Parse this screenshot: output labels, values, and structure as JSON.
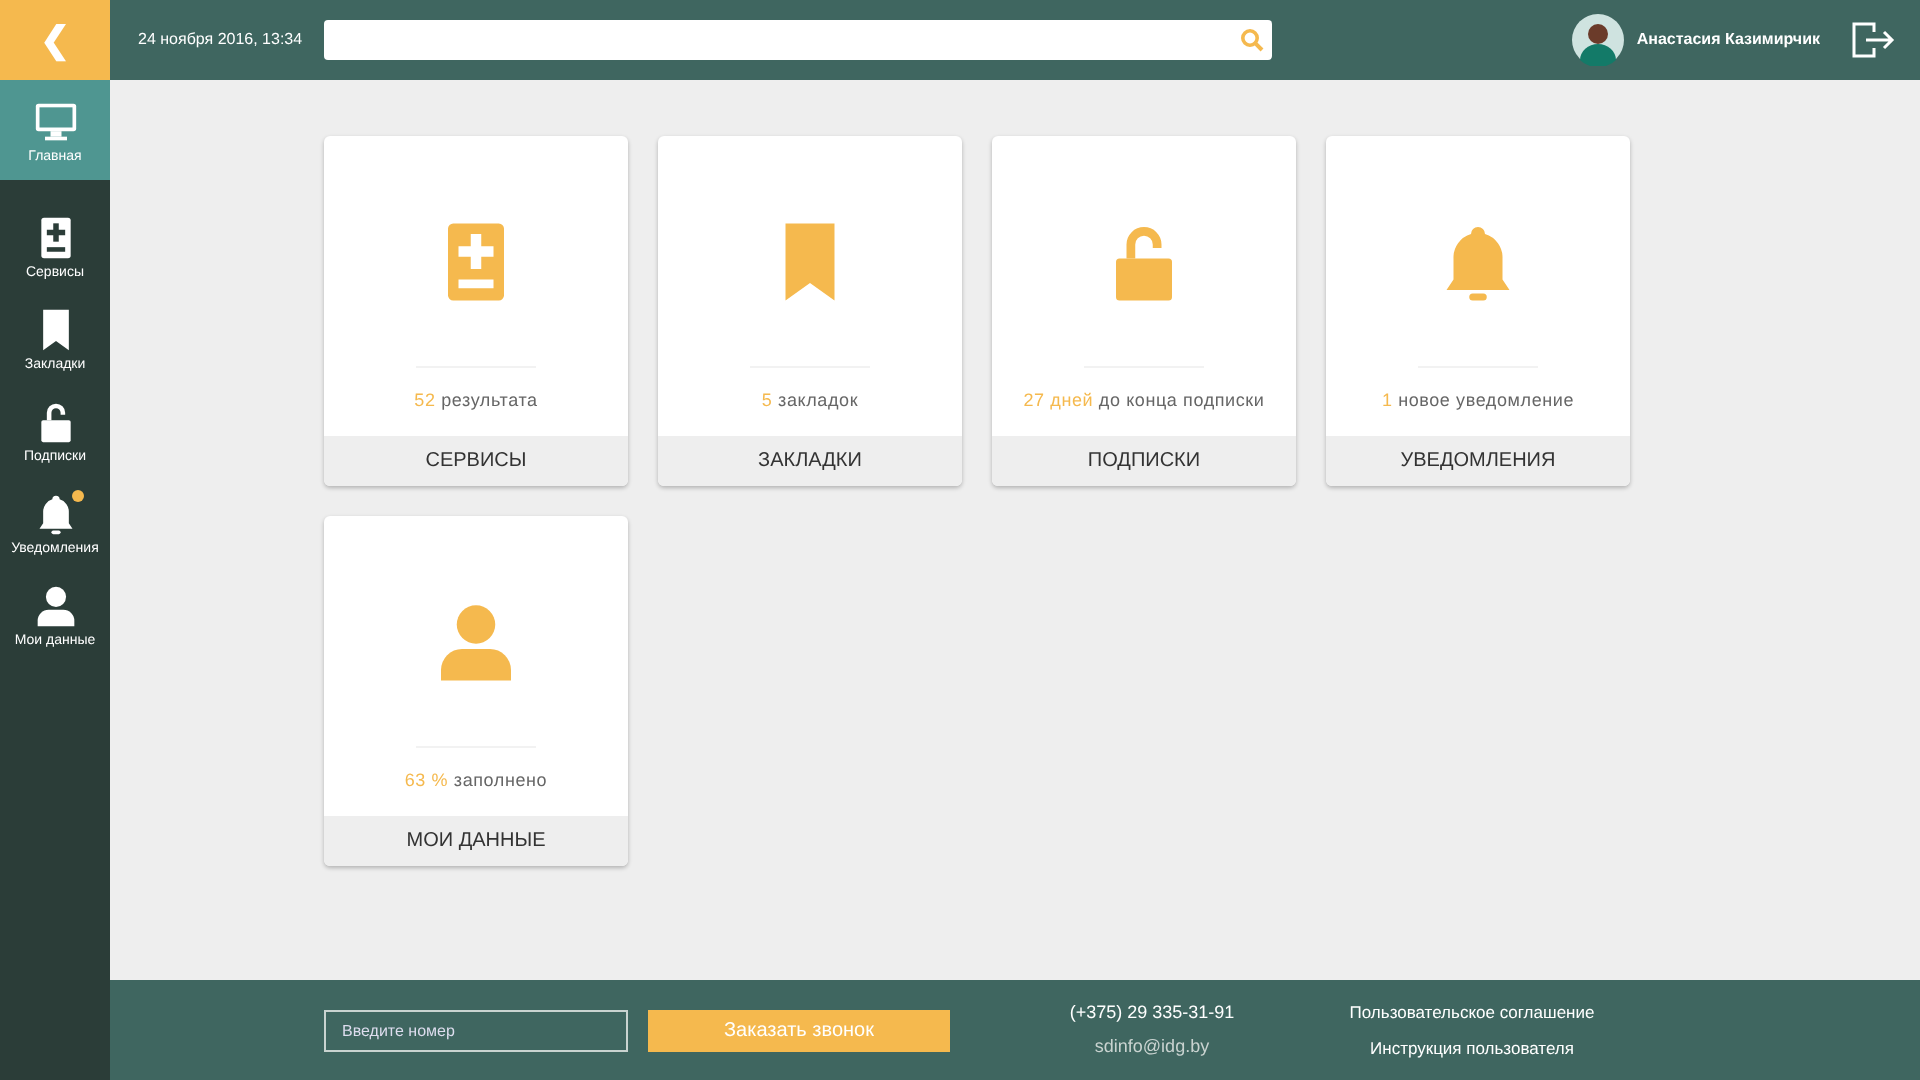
{
  "topbar": {
    "back": "❮",
    "datetime": "24 ноября 2016, 13:34",
    "user_name": "Анастасия Казимирчик"
  },
  "sidebar": {
    "items": [
      {
        "kind": "monitor",
        "label": "Главная",
        "selected": true,
        "badge": false
      },
      {
        "kind": "services",
        "label": "Сервисы",
        "selected": false,
        "badge": false
      },
      {
        "kind": "bookmark",
        "label": "Закладки",
        "selected": false,
        "badge": false
      },
      {
        "kind": "lock",
        "label": "Подписки",
        "selected": false,
        "badge": false
      },
      {
        "kind": "bell",
        "label": "Уведомления",
        "selected": false,
        "badge": true
      },
      {
        "kind": "user",
        "label": "Мои данные",
        "selected": false,
        "badge": false
      }
    ]
  },
  "cards": [
    {
      "kind": "services",
      "count": "52",
      "text": "результата",
      "title": "СЕРВИСЫ"
    },
    {
      "kind": "bookmark",
      "count": "5",
      "text": "закладок",
      "title": "ЗАКЛАДКИ"
    },
    {
      "kind": "lock",
      "count": "27 дней",
      "text": "до конца подписки",
      "title": "ПОДПИСКИ"
    },
    {
      "kind": "bell",
      "count": "1",
      "text": "новое уведомление",
      "title": "УВЕДОМЛЕНИЯ"
    },
    {
      "kind": "user",
      "count": "63 %",
      "text": "заполнено",
      "title": "МОИ ДАННЫЕ"
    }
  ],
  "footer": {
    "phone_placeholder": "Введите номер",
    "call_button": "Заказать звонок",
    "phone": "(+375) 29  335-31-91",
    "email": "sdinfo@idg.by",
    "links": [
      "Пользовательское соглашение",
      "Инструкция пользователя"
    ]
  }
}
